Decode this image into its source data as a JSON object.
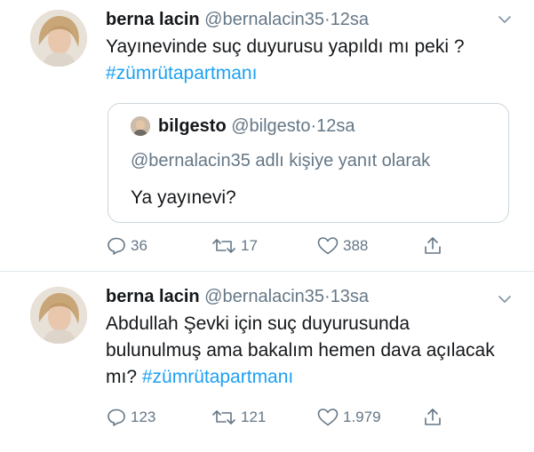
{
  "tweets": [
    {
      "name": "berna lacin",
      "handle": "@bernalacin35",
      "separator": "·",
      "time": "12sa",
      "text_plain": "Yayınevinde suç duyurusu yapıldı mı peki ? ",
      "hashtag": "#zümrütapartmanı",
      "quoted": {
        "name": "bilgesto",
        "handle": "@bilgesto",
        "separator": "·",
        "time": "12sa",
        "reply_context": "@bernalacin35 adlı kişiye yanıt olarak",
        "text": "Ya yayınevi?"
      },
      "counts": {
        "replies": "36",
        "retweets": "17",
        "likes": "388"
      }
    },
    {
      "name": "berna lacin",
      "handle": "@bernalacin35",
      "separator": "·",
      "time": "13sa",
      "text_plain": "Abdullah Şevki için suç duyurusunda bulunulmuş ama bakalım hemen dava açılacak mı? ",
      "hashtag": "#zümrütapartmanı",
      "counts": {
        "replies": "123",
        "retweets": "121",
        "likes": "1.979"
      }
    }
  ],
  "icons": {
    "reply": "reply-icon",
    "retweet": "retweet-icon",
    "like": "heart-icon",
    "share": "share-icon",
    "caret": "chevron-down-icon"
  },
  "colors": {
    "text": "#14171a",
    "secondary": "#657786",
    "hashtag": "#1da1f2",
    "border": "#e1e8ed"
  }
}
